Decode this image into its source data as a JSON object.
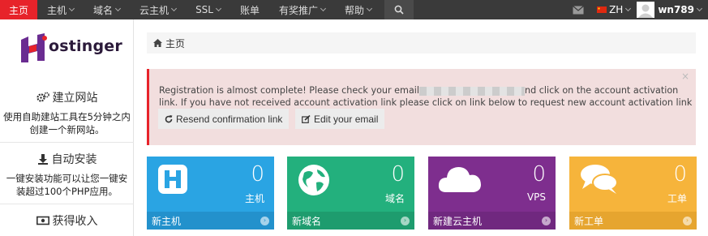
{
  "topnav": {
    "items": [
      {
        "label": "主页",
        "active": true
      },
      {
        "label": "主机",
        "dropdown": true
      },
      {
        "label": "域名",
        "dropdown": true
      },
      {
        "label": "云主机",
        "dropdown": true
      },
      {
        "label": "SSL",
        "dropdown": true
      },
      {
        "label": "账单"
      },
      {
        "label": "有奖推广",
        "dropdown": true
      },
      {
        "label": "帮助",
        "dropdown": true
      }
    ],
    "language": "ZH",
    "username": "wn789",
    "colors": {
      "bar": "#3a3a3a",
      "active": "#e7232a"
    }
  },
  "sidebar": {
    "logo_text": "ostinger",
    "sections": [
      {
        "title": "建立网站",
        "icon": "gears-icon",
        "desc": "使用自助建站工具在5分钟之内创建一个新网站。"
      },
      {
        "title": "自动安装",
        "icon": "download-icon",
        "desc": "一键安装功能可以让您一键安装超过100个PHP应用。"
      },
      {
        "title": "获得收入",
        "icon": "money-icon"
      }
    ]
  },
  "breadcrumb": {
    "home": "主页"
  },
  "alert": {
    "text_part1": "Registration is almost complete! Please check your email",
    "text_part2": "nd click on the account activation link. If you have not received account activation link please click on link below to request new account activation link",
    "close": "×",
    "buttons": {
      "resend": "Resend confirmation link",
      "edit": "Edit your email"
    }
  },
  "tiles": [
    {
      "count": "0",
      "label": "主机",
      "footer": "新主机",
      "color": "#2aa4e3",
      "icon": "hosting-h-icon"
    },
    {
      "count": "0",
      "label": "域名",
      "footer": "新域名",
      "color": "#23b07d",
      "icon": "globe-icon"
    },
    {
      "count": "0",
      "label": "VPS",
      "footer": "新建云主机",
      "color": "#7e2e8e",
      "icon": "cloud-icon"
    },
    {
      "count": "0",
      "label": "工单",
      "footer": "新工单",
      "color": "#f6b43b",
      "icon": "chat-icon"
    }
  ]
}
